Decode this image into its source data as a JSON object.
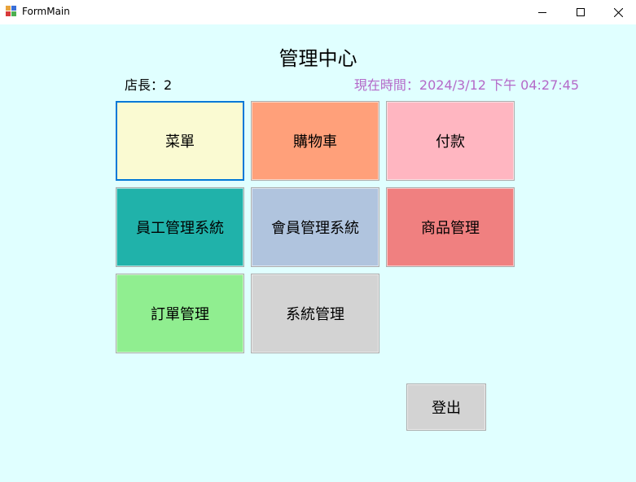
{
  "window": {
    "title": "FormMain",
    "controls": [
      "minimize-icon",
      "maximize-icon",
      "close-icon"
    ]
  },
  "header": {
    "title": "管理中心",
    "manager": "店長：2",
    "time": "現在時間：2024/3/12 下午 04:27:45",
    "time_color": "#b469c8"
  },
  "tiles": [
    {
      "label": "菜單",
      "color": "#fafad2"
    },
    {
      "label": "購物車",
      "color": "#ffa07a"
    },
    {
      "label": "付款",
      "color": "#ffb6c1"
    },
    {
      "label": "員工管理系統",
      "color": "#20b2aa"
    },
    {
      "label": "會員管理系統",
      "color": "#b0c4de"
    },
    {
      "label": "商品管理",
      "color": "#f08080"
    },
    {
      "label": "訂單管理",
      "color": "#90ee90"
    },
    {
      "label": "系統管理",
      "color": "#d3d3d3"
    }
  ],
  "logout": {
    "label": "登出"
  },
  "colors": {
    "background": "#e0ffff",
    "focus_border": "#0078d7"
  }
}
